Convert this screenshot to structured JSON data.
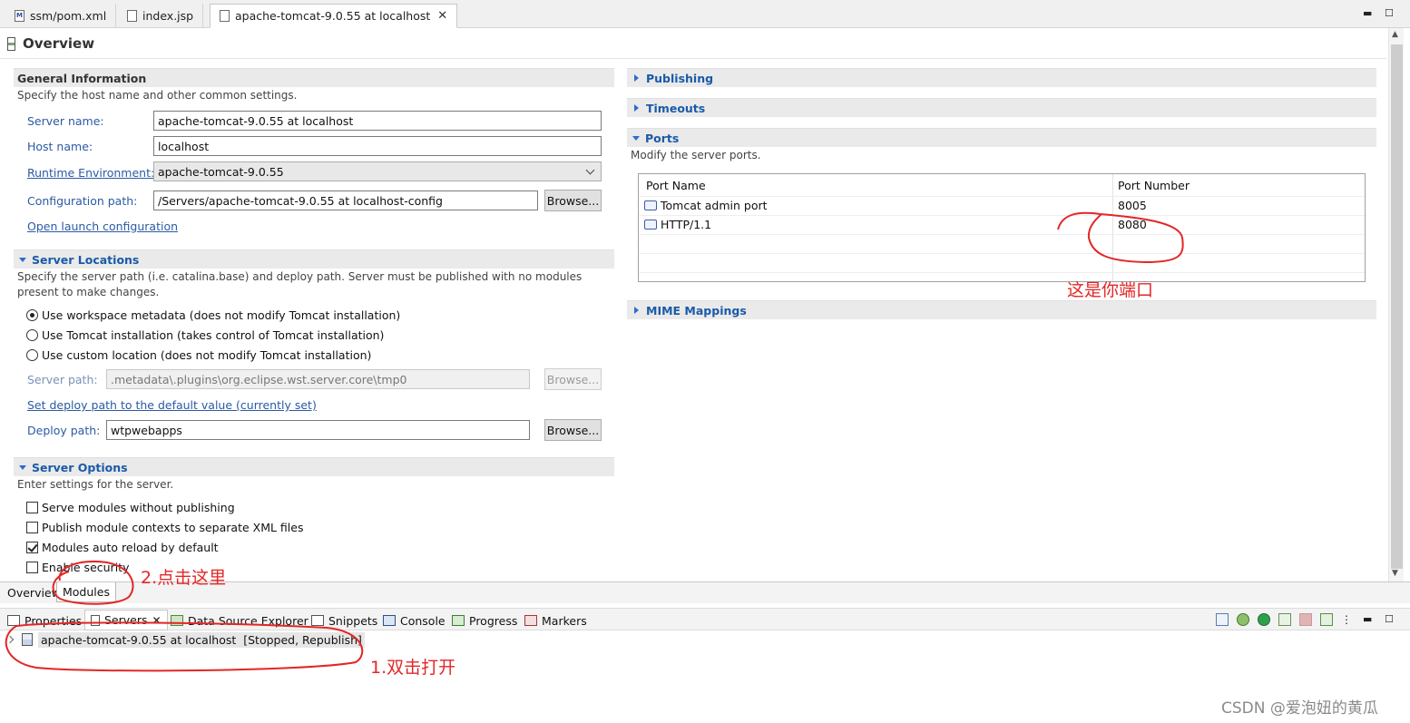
{
  "editor_tabs": [
    {
      "label": "ssm/pom.xml",
      "icon": "maven-file-icon"
    },
    {
      "label": "index.jsp",
      "icon": "jsp-file-icon"
    },
    {
      "label": "apache-tomcat-9.0.55 at localhost",
      "icon": "server-icon",
      "active": true
    }
  ],
  "overview": {
    "title": "Overview"
  },
  "general": {
    "title": "General Information",
    "description": "Specify the host name and other common settings.",
    "server_name_label": "Server name:",
    "server_name_value": "apache-tomcat-9.0.55 at localhost",
    "host_name_label": "Host name:",
    "host_name_value": "localhost",
    "runtime_label": "Runtime Environment:",
    "runtime_value": "apache-tomcat-9.0.55",
    "config_label": "Configuration path:",
    "config_value": "/Servers/apache-tomcat-9.0.55 at localhost-config",
    "browse_label": "Browse...",
    "open_launch_link": "Open launch configuration"
  },
  "locations": {
    "title": "Server Locations",
    "description": "Specify the server path (i.e. catalina.base) and deploy path. Server must be published with no modules present to make changes.",
    "options": [
      {
        "label": "Use workspace metadata (does not modify Tomcat installation)",
        "selected": true
      },
      {
        "label": "Use Tomcat installation (takes control of Tomcat installation)",
        "selected": false
      },
      {
        "label": "Use custom location (does not modify Tomcat installation)",
        "selected": false
      }
    ],
    "server_path_label": "Server path:",
    "server_path_value": ".metadata\\.plugins\\org.eclipse.wst.server.core\\tmp0",
    "browse_label": "Browse...",
    "set_deploy_link": "Set deploy path to the default value (currently set)",
    "deploy_path_label": "Deploy path:",
    "deploy_path_value": "wtpwebapps"
  },
  "server_options": {
    "title": "Server Options",
    "description": "Enter settings for the server.",
    "checks": [
      {
        "label": "Serve modules without publishing",
        "checked": false
      },
      {
        "label": "Publish module contexts to separate XML files",
        "checked": false
      },
      {
        "label": "Modules auto reload by default",
        "checked": true
      },
      {
        "label": "Enable security",
        "checked": false
      }
    ]
  },
  "right": {
    "publishing": "Publishing",
    "timeouts": "Timeouts",
    "ports_title": "Ports",
    "ports_description": "Modify the server ports.",
    "ports_headers": [
      "Port Name",
      "Port Number"
    ],
    "ports": [
      {
        "name": "Tomcat admin port",
        "number": "8005"
      },
      {
        "name": "HTTP/1.1",
        "number": "8080"
      }
    ],
    "mime": "MIME Mappings"
  },
  "page_tabs": [
    {
      "label": "Overview",
      "selected": false
    },
    {
      "label": "Modules",
      "selected": true
    }
  ],
  "views": [
    {
      "label": "Properties",
      "icon": "properties-icon"
    },
    {
      "label": "Servers",
      "icon": "servers-icon",
      "selected": true
    },
    {
      "label": "Data Source Explorer",
      "icon": "data-source-icon"
    },
    {
      "label": "Snippets",
      "icon": "snippets-icon"
    },
    {
      "label": "Console",
      "icon": "console-icon"
    },
    {
      "label": "Progress",
      "icon": "progress-icon"
    },
    {
      "label": "Markers",
      "icon": "markers-icon"
    }
  ],
  "servers_view": {
    "server_label": "apache-tomcat-9.0.55 at localhost",
    "server_state": "[Stopped, Republish]"
  },
  "annotations": {
    "port_note": "这是你端口",
    "click_here": "2.点击这里",
    "double_click": "1.双击打开",
    "color": "#e32626"
  },
  "watermark": "CSDN @爱泡妞的黄瓜"
}
